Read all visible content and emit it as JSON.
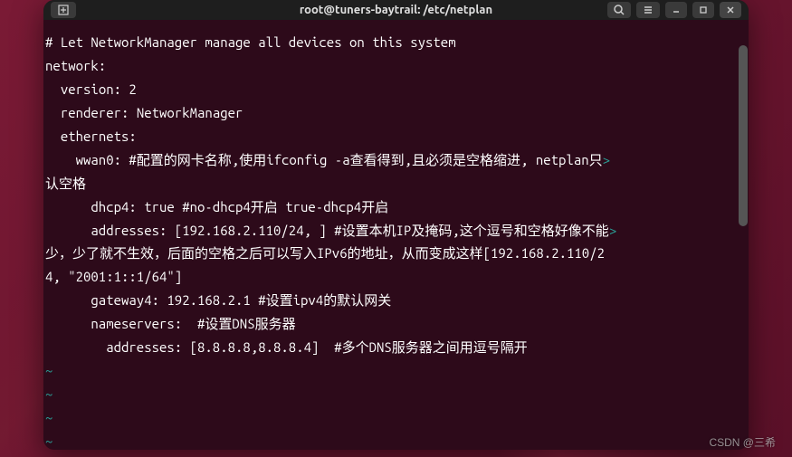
{
  "titlebar": {
    "title": "root@tuners-baytrail: /etc/netplan"
  },
  "editor": {
    "lines": [
      "# Let NetworkManager manage all devices on this system",
      "network:",
      "  version: 2",
      "  renderer: NetworkManager",
      "  ethernets:",
      "    wwan0: #配置的网卡名称,使用ifconfig -a查看得到,且必须是空格缩进, netplan只",
      "认空格",
      "      dhcp4: true #no-dhcp4开启 true-dhcp4开启",
      "      addresses: [192.168.2.110/24, ] #设置本机IP及掩码,这个逗号和空格好像不能",
      "少，少了就不生效，后面的空格之后可以写入IPv6的地址，从而变成这样[192.168.2.110/2",
      "4, \"2001:1::1/64\"]",
      "      gateway4: 192.168.2.1 #设置ipv4的默认网关",
      "      nameservers:  #设置DNS服务器",
      "        addresses: [8.8.8.8,8.8.8.4]  #多个DNS服务器之间用逗号隔开"
    ],
    "wrap_marker": ">",
    "tilde": "~"
  },
  "watermark": "CSDN @三希"
}
